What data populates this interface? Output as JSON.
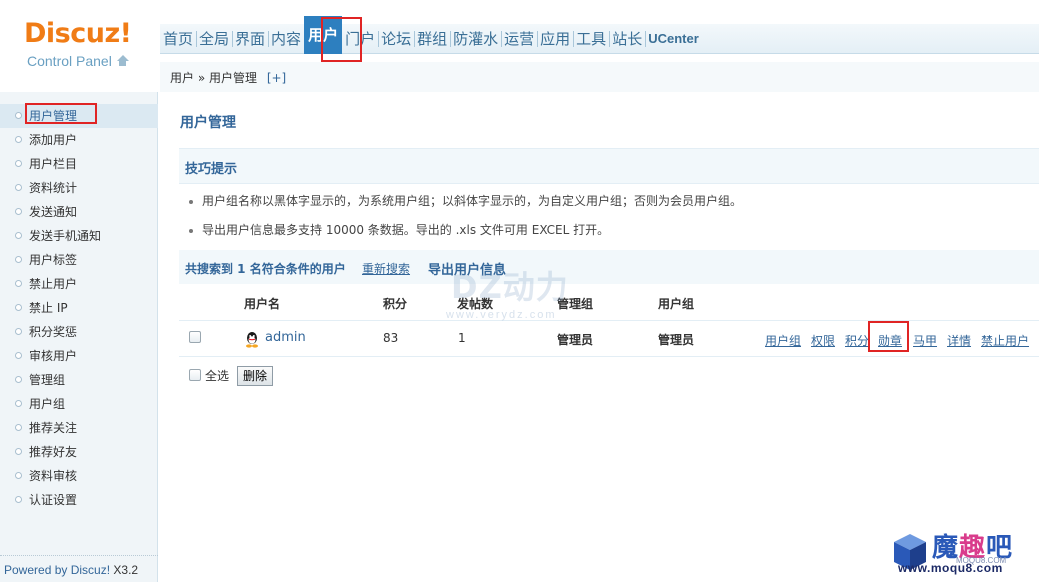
{
  "logo": {
    "brand": "Discuz!",
    "sub": "Control Panel"
  },
  "nav": {
    "items": [
      "首页",
      "全局",
      "界面",
      "内容",
      "用户",
      "门户",
      "论坛",
      "群组",
      "防灌水",
      "运营",
      "应用",
      "工具",
      "站长",
      "UCenter"
    ],
    "active_index": 4
  },
  "breadcrumb": {
    "path": "用户 » 用户管理",
    "add": "[+]"
  },
  "sidebar": {
    "items": [
      "用户管理",
      "添加用户",
      "用户栏目",
      "资料统计",
      "发送通知",
      "发送手机通知",
      "用户标签",
      "禁止用户",
      "禁止 IP",
      "积分奖惩",
      "审核用户",
      "管理组",
      "用户组",
      "推荐关注",
      "推荐好友",
      "资料审核",
      "认证设置"
    ],
    "active_index": 0,
    "powered_by": "Powered by",
    "powered_brand": "Discuz!",
    "version": "X3.2"
  },
  "main": {
    "title": "用户管理",
    "tips_title": "技巧提示",
    "tips": [
      "用户组名称以黑体字显示的，为系统用户组；以斜体字显示的，为自定义用户组；否则为会员用户组。",
      "导出用户信息最多支持 10000 条数据。导出的 .xls 文件可用 EXCEL 打开。"
    ],
    "result_text": "共搜索到 1 名符合条件的用户",
    "research_link": "重新搜索",
    "export_link": "导出用户信息",
    "table": {
      "headers": [
        "用户名",
        "积分",
        "发帖数",
        "管理组",
        "用户组"
      ],
      "rows": [
        {
          "username": "admin",
          "credits": "83",
          "posts": "1",
          "admin_group": "管理员",
          "user_group": "管理员",
          "ops": [
            "用户组",
            "权限",
            "积分",
            "勋章",
            "马甲",
            "详情",
            "禁止用户"
          ]
        }
      ]
    },
    "select_all": "全选",
    "delete_button": "删除"
  },
  "watermarks": {
    "dz_text": "DZ动力",
    "dz_url": "www.verydz.com",
    "site_title_a": "魔",
    "site_title_b": "趣",
    "site_title_c": "吧",
    "site_url": "www.moqu8.com",
    "site_tiny": "MOQU8.COM"
  }
}
